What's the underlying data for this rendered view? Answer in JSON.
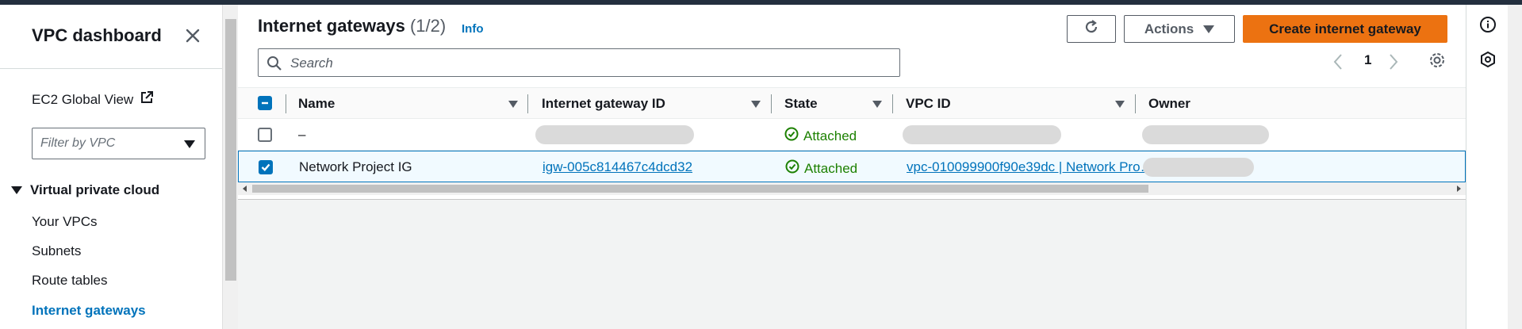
{
  "sidebar": {
    "title": "VPC dashboard",
    "ec2_link": "EC2 Global View",
    "filter_placeholder": "Filter by VPC",
    "section": "Virtual private cloud",
    "items": [
      {
        "label": "Your VPCs"
      },
      {
        "label": "Subnets"
      },
      {
        "label": "Route tables"
      },
      {
        "label": "Internet gateways",
        "active": true
      }
    ]
  },
  "panel": {
    "title": "Internet gateways",
    "count": "(1/2)",
    "info": "Info",
    "actions_label": "Actions",
    "create_label": "Create internet gateway",
    "search_placeholder": "Search",
    "page": "1"
  },
  "table": {
    "columns": [
      "Name",
      "Internet gateway ID",
      "State",
      "VPC ID",
      "Owner"
    ],
    "rows": [
      {
        "name": "–",
        "gateway_id": "",
        "state": "Attached",
        "vpc_id": "",
        "owner": "",
        "selected": false
      },
      {
        "name": "Network Project IG",
        "gateway_id": "igw-005c814467c4dcd32",
        "state": "Attached",
        "vpc_id": "vpc-010099900f90e39dc | Network Pro…",
        "owner": "",
        "selected": true
      }
    ]
  },
  "colors": {
    "accent": "#0073bb",
    "primary_button": "#ec7211",
    "success": "#1d8102",
    "topbar": "#232f3e"
  }
}
